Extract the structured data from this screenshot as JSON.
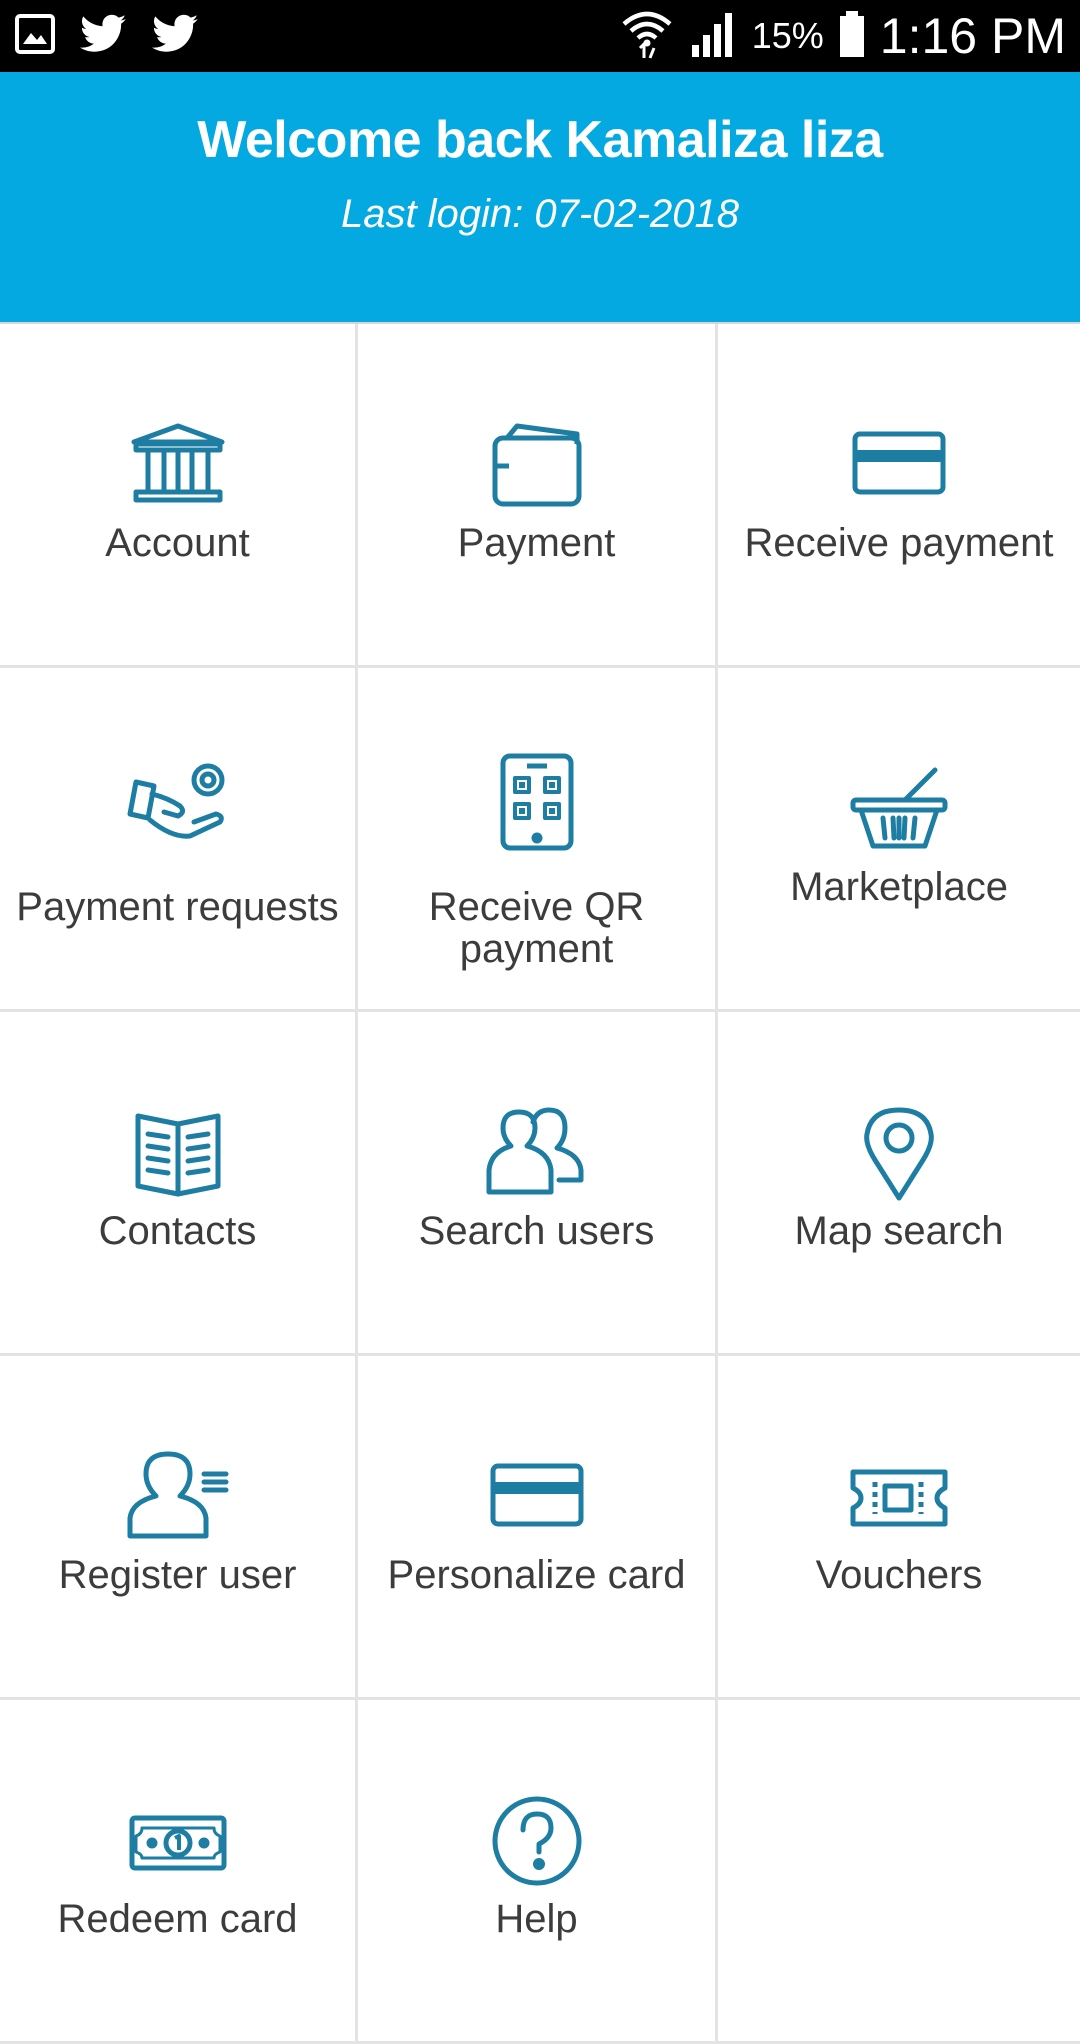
{
  "status_bar": {
    "battery_percent": "15%",
    "time": "1:16 PM",
    "icons": [
      "gallery-icon",
      "twitter-icon",
      "twitter-icon",
      "wifi-icon",
      "signal-icon",
      "battery-icon"
    ]
  },
  "header": {
    "welcome": "Welcome back Kamaliza liza",
    "last_login": "Last login: 07-02-2018"
  },
  "colors": {
    "header_bg": "#03a9e0",
    "icon": "#1d7da3",
    "text": "#3c3c3c"
  },
  "menu": [
    {
      "label": "Account",
      "icon": "bank-icon"
    },
    {
      "label": "Payment",
      "icon": "wallet-icon"
    },
    {
      "label": "Receive payment",
      "icon": "credit-card-icon"
    },
    {
      "label": "Payment requests",
      "icon": "hand-coin-icon"
    },
    {
      "label": "Receive QR payment",
      "icon": "qr-phone-icon"
    },
    {
      "label": "Marketplace",
      "icon": "basket-icon"
    },
    {
      "label": "Contacts",
      "icon": "book-icon"
    },
    {
      "label": "Search users",
      "icon": "users-icon"
    },
    {
      "label": "Map search",
      "icon": "map-pin-icon"
    },
    {
      "label": "Register user",
      "icon": "user-list-icon"
    },
    {
      "label": "Personalize card",
      "icon": "credit-card-icon"
    },
    {
      "label": "Vouchers",
      "icon": "ticket-icon"
    },
    {
      "label": "Redeem card",
      "icon": "banknote-icon"
    },
    {
      "label": "Help",
      "icon": "question-icon"
    }
  ]
}
